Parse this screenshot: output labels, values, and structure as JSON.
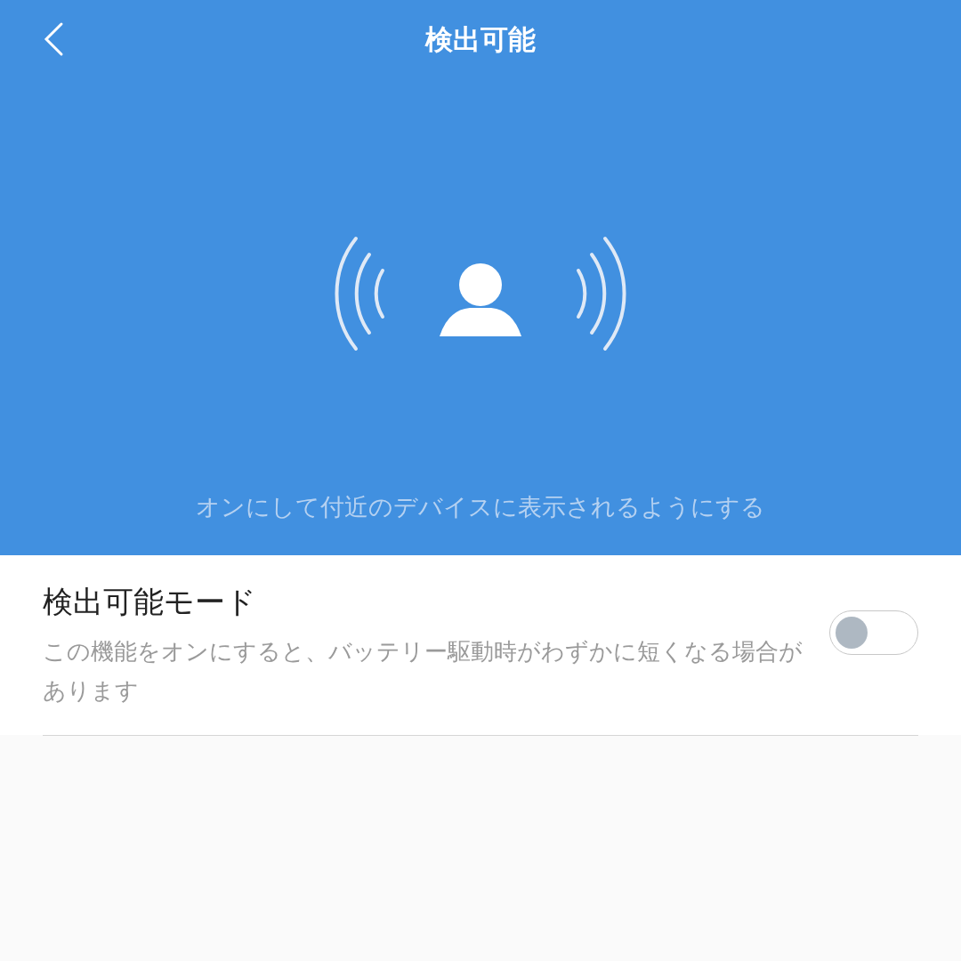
{
  "header": {
    "title": "検出可能",
    "hint": "オンにして付近のデバイスに表示されるようにする"
  },
  "setting": {
    "label": "検出可能モード",
    "description": "この機能をオンにすると、バッテリー駆動時がわずかに短くなる場合があります",
    "on": false
  }
}
